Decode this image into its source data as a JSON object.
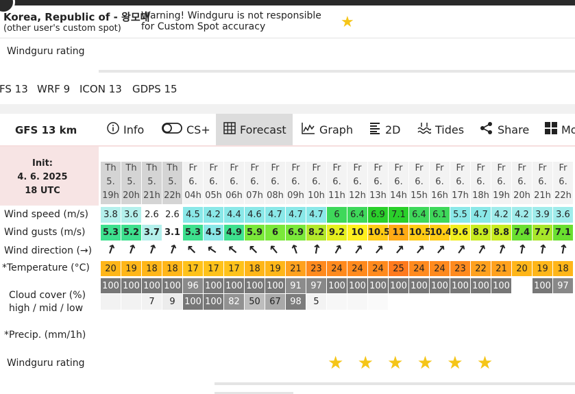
{
  "spot": {
    "title": "Korea, Republic of - 왕모대",
    "subtitle": "(other user's custom spot)",
    "warning_line1": "Warning! Windguru is not responsible",
    "warning_line2": "for Custom Spot accuracy",
    "favorite_icon": "star-icon"
  },
  "rating_label": "Windguru rating",
  "models": [
    "FS 13",
    "WRF 9",
    "ICON 13",
    "GDPS 15"
  ],
  "model_name": "GFS 13 km",
  "tabs": [
    {
      "label": "Info",
      "icon": "info-icon"
    },
    {
      "label": "CS+",
      "icon": "toggle-icon"
    },
    {
      "label": "Forecast",
      "icon": "grid-icon",
      "active": true
    },
    {
      "label": "Graph",
      "icon": "chart-icon"
    },
    {
      "label": "2D",
      "icon": "list-icon"
    },
    {
      "label": "Tides",
      "icon": "tides-icon"
    },
    {
      "label": "Share",
      "icon": "share-icon"
    },
    {
      "label": "Mo",
      "icon": "more-icon"
    }
  ],
  "init": {
    "label": "Init:",
    "date": "4. 6. 2025",
    "time": "18 UTC"
  },
  "row_labels": {
    "wind_speed": "Wind speed (m/s)",
    "wind_gusts": "Wind gusts (m/s)",
    "wind_direction": "Wind direction (→)",
    "temperature": "*Temperature (°C)",
    "cloud_line1": "Cloud cover (%)",
    "cloud_line2": "high / mid / low",
    "precip": "*Precip. (mm/1h)",
    "rating": "Windguru rating"
  },
  "hours": [
    {
      "day": "Th",
      "date": "5.",
      "hour": "19h"
    },
    {
      "day": "Th",
      "date": "5.",
      "hour": "20h"
    },
    {
      "day": "Th",
      "date": "5.",
      "hour": "21h"
    },
    {
      "day": "Th",
      "date": "5.",
      "hour": "22h"
    },
    {
      "day": "Fr",
      "date": "6.",
      "hour": "04h"
    },
    {
      "day": "Fr",
      "date": "6.",
      "hour": "05h"
    },
    {
      "day": "Fr",
      "date": "6.",
      "hour": "06h"
    },
    {
      "day": "Fr",
      "date": "6.",
      "hour": "07h"
    },
    {
      "day": "Fr",
      "date": "6.",
      "hour": "08h"
    },
    {
      "day": "Fr",
      "date": "6.",
      "hour": "09h"
    },
    {
      "day": "Fr",
      "date": "6.",
      "hour": "10h"
    },
    {
      "day": "Fr",
      "date": "6.",
      "hour": "11h"
    },
    {
      "day": "Fr",
      "date": "6.",
      "hour": "12h"
    },
    {
      "day": "Fr",
      "date": "6.",
      "hour": "13h"
    },
    {
      "day": "Fr",
      "date": "6.",
      "hour": "14h"
    },
    {
      "day": "Fr",
      "date": "6.",
      "hour": "15h"
    },
    {
      "day": "Fr",
      "date": "6.",
      "hour": "16h"
    },
    {
      "day": "Fr",
      "date": "6.",
      "hour": "17h"
    },
    {
      "day": "Fr",
      "date": "6.",
      "hour": "18h"
    },
    {
      "day": "Fr",
      "date": "6.",
      "hour": "19h"
    },
    {
      "day": "Fr",
      "date": "6.",
      "hour": "20h"
    },
    {
      "day": "Fr",
      "date": "6.",
      "hour": "21h"
    },
    {
      "day": "Fr",
      "date": "6.",
      "hour": "22h"
    }
  ],
  "wind_speed": [
    "3.8",
    "3.6",
    "2.6",
    "2.6",
    "4.5",
    "4.2",
    "4.4",
    "4.6",
    "4.7",
    "4.7",
    "4.7",
    "6",
    "6.4",
    "6.9",
    "7.1",
    "6.4",
    "6.1",
    "5.5",
    "4.7",
    "4.2",
    "4.2",
    "3.9",
    "3.6"
  ],
  "wind_gusts": [
    "5.3",
    "5.2",
    "3.7",
    "3.1",
    "5.3",
    "4.5",
    "4.9",
    "5.9",
    "6",
    "6.9",
    "8.2",
    "9.2",
    "10",
    "10.5",
    "11",
    "10.5",
    "10.4",
    "9.6",
    "8.9",
    "8.8",
    "7.4",
    "7.7",
    "7.1"
  ],
  "wind_direction_deg": [
    20,
    20,
    20,
    20,
    -45,
    -55,
    -50,
    -45,
    -40,
    -20,
    10,
    30,
    35,
    40,
    40,
    40,
    40,
    35,
    30,
    20,
    10,
    10,
    10
  ],
  "temperature": [
    "20",
    "19",
    "18",
    "18",
    "17",
    "17",
    "17",
    "18",
    "19",
    "21",
    "23",
    "24",
    "24",
    "24",
    "25",
    "24",
    "24",
    "23",
    "22",
    "21",
    "20",
    "19",
    "18"
  ],
  "cloud_high": [
    "100",
    "100",
    "100",
    "100",
    "96",
    "100",
    "100",
    "100",
    "100",
    "91",
    "97",
    "100",
    "100",
    "100",
    "100",
    "100",
    "100",
    "100",
    "100",
    "100",
    "",
    "100",
    "97"
  ],
  "cloud_mid": [
    "",
    "",
    "7",
    "9",
    "100",
    "100",
    "82",
    "50",
    "67",
    "98",
    "5",
    "",
    "",
    "",
    "",
    "",
    "",
    "",
    "",
    "",
    "",
    "",
    ""
  ],
  "rating_stars": "★ ★ ★ ★ ★ ★",
  "colors": {
    "speed_cells": [
      "#b4f0ec",
      "#b4f0ec",
      "#ffffff",
      "#ffffff",
      "#8ae8e8",
      "#8ae8e8",
      "#8ae8e8",
      "#8ae8e8",
      "#8ae8e8",
      "#8ae8e8",
      "#8ae8e8",
      "#3ed85a",
      "#3ed85a",
      "#2ad02a",
      "#2ad02a",
      "#3ed85a",
      "#3ed85a",
      "#8ae8e8",
      "#8ae8e8",
      "#a0eceb",
      "#a0eceb",
      "#a0eceb",
      "#a0eceb"
    ],
    "gust_cells": [
      "#3ee08e",
      "#3ee08e",
      "#b4f0ec",
      "#ffffff",
      "#3ee08e",
      "#8ae8e8",
      "#3ee08e",
      "#7ae83a",
      "#7ae83a",
      "#7ae83a",
      "#b2e82a",
      "#e6f01e",
      "#fff01e",
      "#ffcc14",
      "#ffaa14",
      "#ffcc14",
      "#ffcc14",
      "#f2ee1e",
      "#c8ec20",
      "#c8ec20",
      "#6adf30",
      "#a8e62a",
      "#6adf30"
    ],
    "temp_cells": [
      "#ffb619",
      "#ffb619",
      "#ffb619",
      "#ffb619",
      "#ffc21a",
      "#ffc21a",
      "#ffc21a",
      "#ffb619",
      "#ffb619",
      "#ffa11e",
      "#ff8a1e",
      "#ff8a1e",
      "#ff8a1e",
      "#ff8a1e",
      "#ff7a1e",
      "#ff8a1e",
      "#ff8a1e",
      "#ff8a1e",
      "#ffa11e",
      "#ffa11e",
      "#ffb619",
      "#ffb619",
      "#ffb619"
    ],
    "cloud_high_cells": [
      "#777",
      "#777",
      "#777",
      "#777",
      "#8a8a8a",
      "#777",
      "#777",
      "#777",
      "#777",
      "#8c8c8c",
      "#888",
      "#777",
      "#777",
      "#777",
      "#777",
      "#777",
      "#777",
      "#777",
      "#777",
      "#777",
      "#ffffff",
      "#777",
      "#888"
    ],
    "cloud_mid_cells": [
      "#f2f2f2",
      "#f2f2f2",
      "#f2f2f2",
      "#ececec",
      "#777",
      "#777",
      "#929292",
      "#bdbdbd",
      "#a9a9a9",
      "#7c7c7c",
      "#f3f3f3",
      "#f7f7f7",
      "#f7f7f7",
      "#fafafa",
      "#ffffff",
      "#ffffff",
      "#ffffff",
      "#ffffff",
      "#ffffff",
      "#ffffff",
      "#ffffff",
      "#ffffff",
      "#ffffff"
    ],
    "header_cells": [
      "#d4d4d4",
      "#d4d4d4",
      "#d4d4d4",
      "#d4d4d4",
      "#f3f3f3",
      "#f3f3f3",
      "#f3f3f3",
      "#f3f3f3",
      "#f3f3f3",
      "#f3f3f3",
      "#f3f3f3",
      "#f3f3f3",
      "#f3f3f3",
      "#f3f3f3",
      "#f3f3f3",
      "#f3f3f3",
      "#f3f3f3",
      "#f3f3f3",
      "#f3f3f3",
      "#f3f3f3",
      "#f3f3f3",
      "#f3f3f3",
      "#f3f3f3"
    ]
  }
}
